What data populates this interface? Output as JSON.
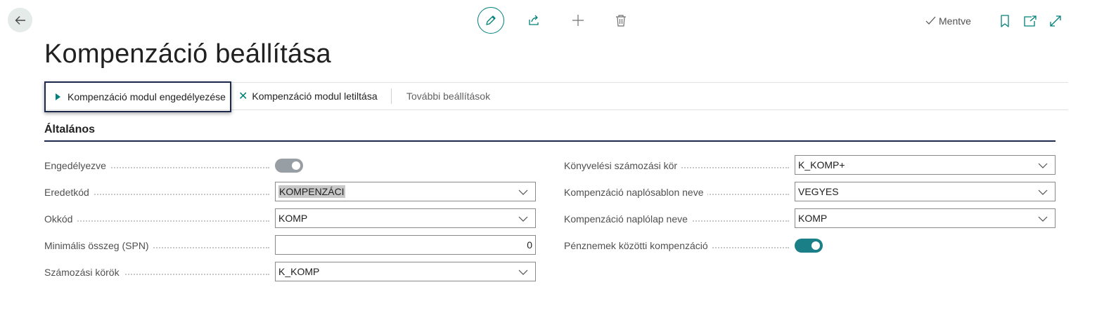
{
  "page": {
    "title": "Kompenzáció beállítása",
    "status": "Mentve"
  },
  "actions": {
    "enable": "Kompenzáció modul engedélyezése",
    "disable": "Kompenzáció modul letiltása",
    "more": "További beállítások"
  },
  "section": {
    "title": "Általános"
  },
  "left_fields": {
    "enabled": {
      "label": "Engedélyezve",
      "value": false
    },
    "source_code": {
      "label": "Eredetkód",
      "value": "KOMPENZÁCI"
    },
    "reason_code": {
      "label": "Okkód",
      "value": "KOMP"
    },
    "min_amount": {
      "label": "Minimális összeg (SPN)",
      "value": "0"
    },
    "number_series": {
      "label": "Számozási körök",
      "value": "K_KOMP"
    }
  },
  "right_fields": {
    "posting_series": {
      "label": "Könyvelési számozási kör",
      "value": "K_KOMP+"
    },
    "journal_template": {
      "label": "Kompenzáció naplósablon neve",
      "value": "VEGYES"
    },
    "journal_batch": {
      "label": "Kompenzáció naplólap neve",
      "value": "KOMP"
    },
    "currency_comp": {
      "label": "Pénznemek közötti kompenzáció",
      "value": true
    }
  },
  "colors": {
    "accent": "#00807b",
    "toggle_on": "#1a7f86",
    "toggle_off": "#979ea4",
    "rule": "#1d2a4e"
  },
  "icons": [
    "back-arrow-icon",
    "pencil-icon",
    "share-icon",
    "plus-icon",
    "trash-icon",
    "check-icon",
    "bookmark-icon",
    "open-new-window-icon",
    "expand-icon",
    "play-icon",
    "close-x-icon",
    "chevron-down-icon"
  ]
}
